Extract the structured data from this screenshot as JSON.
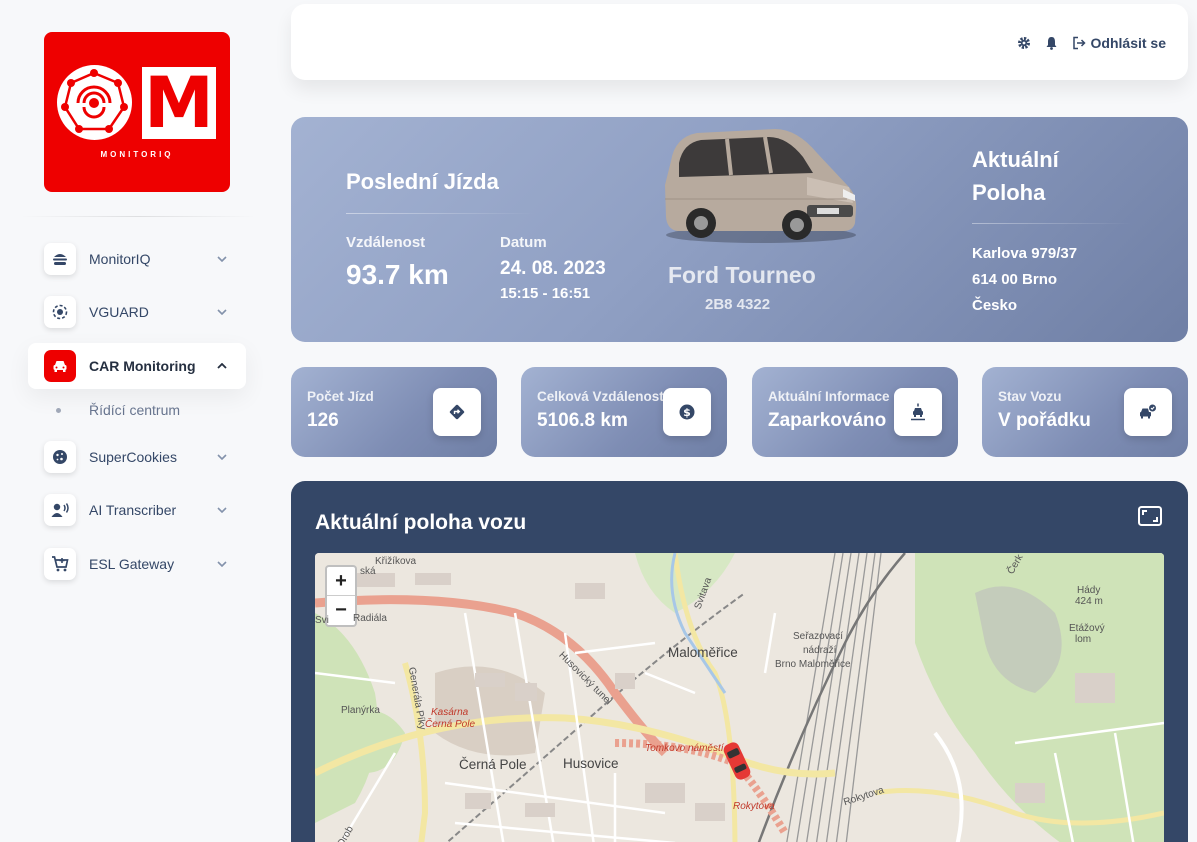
{
  "brand": {
    "logo_text": "MONITORIQ",
    "logo_letter": "M",
    "accent": "#ee0000"
  },
  "sidebar": {
    "items": [
      {
        "label": "MonitorIQ",
        "icon": "burger-icon"
      },
      {
        "label": "VGUARD",
        "icon": "target-icon"
      },
      {
        "label": "CAR Monitoring",
        "icon": "car-icon",
        "active": true
      },
      {
        "label": "SuperCookies",
        "icon": "cookie-icon"
      },
      {
        "label": "AI Transcriber",
        "icon": "voice-user-icon"
      },
      {
        "label": "ESL Gateway",
        "icon": "cart-icon"
      }
    ],
    "subitem": "Řídící centrum"
  },
  "topbar": {
    "logout": "Odhlásit se"
  },
  "hero": {
    "title": "Poslední Jízda",
    "distance_label": "Vzdálenost",
    "distance_value": "93.7 km",
    "date_label": "Datum",
    "date_value": "24. 08. 2023",
    "time_value": "15:15 - 16:51",
    "car_name": "Ford Tourneo",
    "car_plate": "2B8 4322",
    "location_title_1": "Aktuální",
    "location_title_2": "Poloha",
    "address_1": "Karlova 979/37",
    "address_2": "614 00 Brno",
    "address_3": "Česko"
  },
  "stats": [
    {
      "label": "Počet Jízd",
      "value": "126",
      "icon": "directions-icon"
    },
    {
      "label": "Celková Vzdálenost",
      "value": "5106.8 km",
      "icon": "dollar-icon"
    },
    {
      "label": "Aktuální Informace",
      "value": "Zaparkováno",
      "icon": "parked-car-icon"
    },
    {
      "label": "Stav Vozu",
      "value": "V pořádku",
      "icon": "car-check-icon"
    }
  ],
  "map": {
    "title": "Aktuální poloha vozu",
    "zoom_in": "+",
    "zoom_out": "−",
    "labels": {
      "krizikova": "Křižíkova",
      "skaska": "ská",
      "radiala": "Radiála",
      "svi": "Svi",
      "svitava": "Svitava",
      "malomerice": "Maloměřice",
      "seradovaci_1": "Seřazovací",
      "seradovaci_2": "nádraží",
      "seradovaci_3": "Brno Maloměřice",
      "husovicky": "Husovický tunel",
      "generala": "Generála Píky",
      "planyrka": "Planýrka",
      "kasarna_1": "Kasárna",
      "kasarna_2": "Černá Pole",
      "cerna_pole": "Černá Pole",
      "husovice": "Husovice",
      "tomkovo": "Tomkovo náměstí",
      "rokytova_1": "Rokytova",
      "rokytova_2": "Rokytova",
      "hady_1": "Hády",
      "hady_2": "424 m",
      "etazovy_1": "Etážový",
      "etazovy_2": "lom",
      "drob": "Drob",
      "cerk": "Čerk"
    }
  }
}
